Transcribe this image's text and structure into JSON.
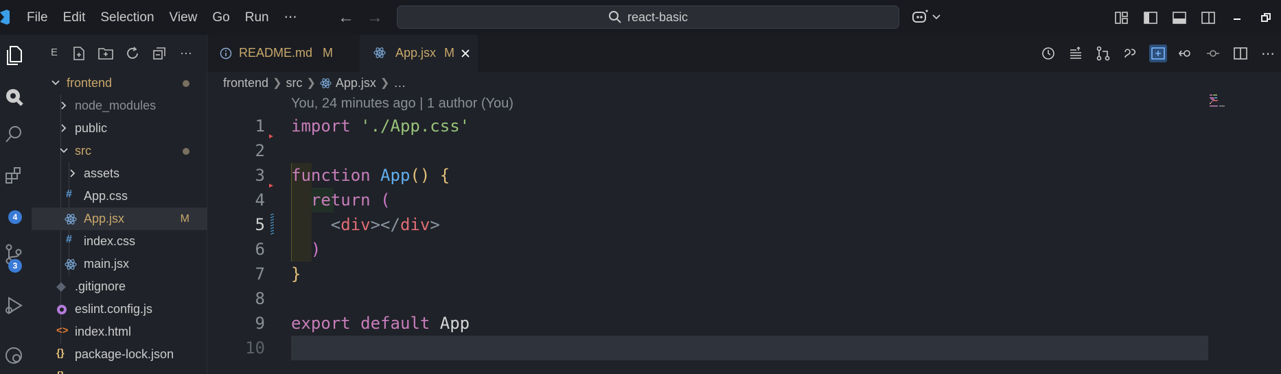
{
  "menu": [
    "File",
    "Edit",
    "Selection",
    "View",
    "Go",
    "Run",
    "⋯"
  ],
  "search": {
    "text": "react-basic"
  },
  "sidebar": {
    "title": "E",
    "tree": [
      {
        "label": "frontend",
        "type": "folder-open",
        "depth": 0,
        "status": "dot"
      },
      {
        "label": "node_modules",
        "type": "folder",
        "depth": 1,
        "dimmed": true
      },
      {
        "label": "public",
        "type": "folder",
        "depth": 1
      },
      {
        "label": "src",
        "type": "folder-open",
        "depth": 1,
        "status": "dot"
      },
      {
        "label": "assets",
        "type": "folder",
        "depth": 2
      },
      {
        "label": "App.css",
        "type": "css",
        "depth": 2
      },
      {
        "label": "App.jsx",
        "type": "react",
        "depth": 2,
        "badge": "M",
        "selected": true
      },
      {
        "label": "index.css",
        "type": "css",
        "depth": 2
      },
      {
        "label": "main.jsx",
        "type": "react",
        "depth": 2
      },
      {
        "label": ".gitignore",
        "type": "git",
        "depth": 1
      },
      {
        "label": "eslint.config.js",
        "type": "eslint",
        "depth": 1
      },
      {
        "label": "index.html",
        "type": "html",
        "depth": 1
      },
      {
        "label": "package-lock.json",
        "type": "json",
        "depth": 1
      }
    ]
  },
  "activity": {
    "extensions_badge": "4",
    "scm_badge": "3"
  },
  "tabs": [
    {
      "label": "README.md",
      "badge": "M",
      "icon": "info-icon"
    },
    {
      "label": "App.jsx",
      "badge": "M",
      "icon": "react-icon",
      "active": true
    }
  ],
  "breadcrumb": [
    "frontend",
    "src",
    "App.jsx",
    "…"
  ],
  "editor": {
    "blame": "You, 24 minutes ago | 1 author (You)",
    "line_numbers": [
      "1",
      "2",
      "3",
      "4",
      "5",
      "6",
      "7",
      "8",
      "9",
      "10"
    ],
    "lines": {
      "l1_kw": "import",
      "l1_str": "'./App.css'",
      "l3_kw": "function",
      "l3_fn": "App",
      "l3_paren": "()",
      "l3_brace": "{",
      "l4_kw": "return",
      "l4_paren": "(",
      "l5_open_lt": "<",
      "l5_open_tag": "div",
      "l5_mid": "></",
      "l5_close_tag": "div",
      "l5_end": ">",
      "l6_paren": ")",
      "l7_brace": "}",
      "l9_kw1": "export",
      "l9_kw2": "default",
      "l9_id": "App"
    }
  },
  "colors": {
    "accent": "#3a7bd5",
    "modified": "#c9a86b",
    "keyword": "#c77dba",
    "string": "#98c379",
    "function": "#61afef"
  }
}
